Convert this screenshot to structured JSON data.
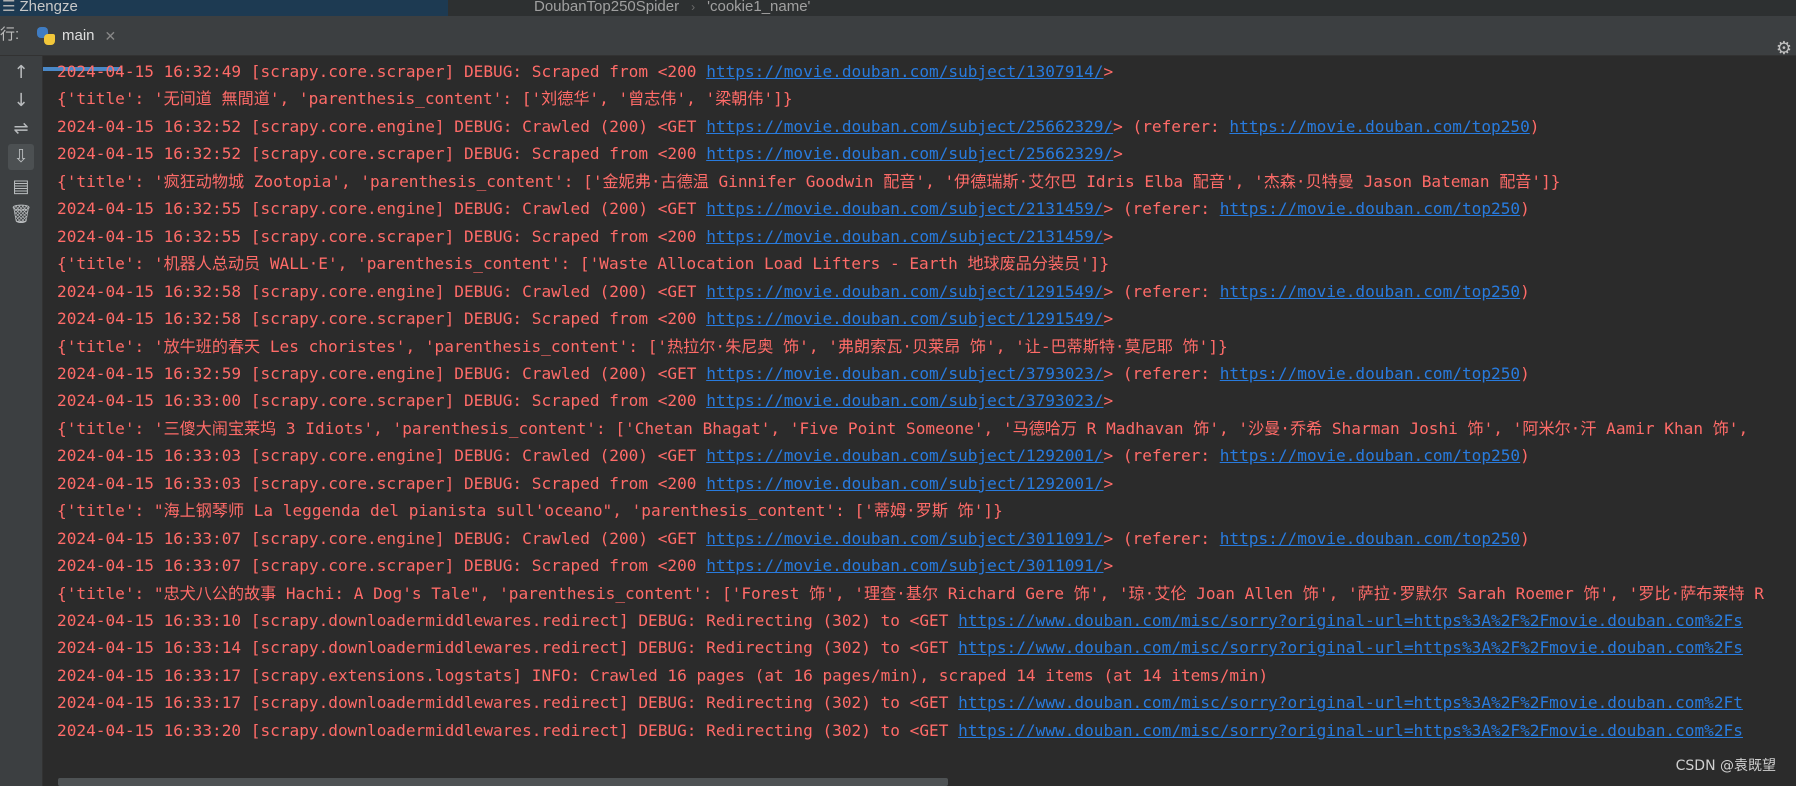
{
  "topbar": {
    "project_name": "Zhengze",
    "crumb_file": "DoubanTop250Spider",
    "crumb_symbol": "'cookie1_name'"
  },
  "run_panel": {
    "label": "行:",
    "tab_label": "main"
  },
  "toolbar": {
    "buttons": [
      "up-arrow-icon",
      "down-arrow-icon",
      "soft-wrap-icon",
      "scroll-to-end-icon",
      "print-icon",
      "trash-icon"
    ]
  },
  "console": {
    "text_color": "#ff6b68",
    "link_color": "#287bde",
    "lines": [
      {
        "text": "2024-04-15 16:32:49 [scrapy.core.scraper] DEBUG: Scraped from <200 ",
        "link": "https://movie.douban.com/subject/1307914/",
        "after": ">"
      },
      {
        "text": "{'title': '无间道 無間道', 'parenthesis_content': ['刘德华', '曾志伟', '梁朝伟']}"
      },
      {
        "text": "2024-04-15 16:32:52 [scrapy.core.engine] DEBUG: Crawled (200) <GET ",
        "link": "https://movie.douban.com/subject/25662329/",
        "after": "> (referer: ",
        "link2": "https://movie.douban.com/top250",
        "after2": ")"
      },
      {
        "text": "2024-04-15 16:32:52 [scrapy.core.scraper] DEBUG: Scraped from <200 ",
        "link": "https://movie.douban.com/subject/25662329/",
        "after": ">"
      },
      {
        "text": "{'title': '疯狂动物城 Zootopia', 'parenthesis_content': ['金妮弗·古德温 Ginnifer Goodwin 配音', '伊德瑞斯·艾尔巴 Idris Elba 配音', '杰森·贝特曼 Jason Bateman 配音']}"
      },
      {
        "text": "2024-04-15 16:32:55 [scrapy.core.engine] DEBUG: Crawled (200) <GET ",
        "link": "https://movie.douban.com/subject/2131459/",
        "after": "> (referer: ",
        "link2": "https://movie.douban.com/top250",
        "after2": ")"
      },
      {
        "text": "2024-04-15 16:32:55 [scrapy.core.scraper] DEBUG: Scraped from <200 ",
        "link": "https://movie.douban.com/subject/2131459/",
        "after": ">"
      },
      {
        "text": "{'title': '机器人总动员 WALL·E', 'parenthesis_content': ['Waste Allocation Load Lifters - Earth 地球废品分装员']}"
      },
      {
        "text": "2024-04-15 16:32:58 [scrapy.core.engine] DEBUG: Crawled (200) <GET ",
        "link": "https://movie.douban.com/subject/1291549/",
        "after": "> (referer: ",
        "link2": "https://movie.douban.com/top250",
        "after2": ")"
      },
      {
        "text": "2024-04-15 16:32:58 [scrapy.core.scraper] DEBUG: Scraped from <200 ",
        "link": "https://movie.douban.com/subject/1291549/",
        "after": ">"
      },
      {
        "text": "{'title': '放牛班的春天 Les choristes', 'parenthesis_content': ['热拉尔·朱尼奥 饰', '弗朗索瓦·贝莱昂 饰', '让-巴蒂斯特·莫尼耶 饰']}"
      },
      {
        "text": "2024-04-15 16:32:59 [scrapy.core.engine] DEBUG: Crawled (200) <GET ",
        "link": "https://movie.douban.com/subject/3793023/",
        "after": "> (referer: ",
        "link2": "https://movie.douban.com/top250",
        "after2": ")"
      },
      {
        "text": "2024-04-15 16:33:00 [scrapy.core.scraper] DEBUG: Scraped from <200 ",
        "link": "https://movie.douban.com/subject/3793023/",
        "after": ">"
      },
      {
        "text": "{'title': '三傻大闹宝莱坞 3 Idiots', 'parenthesis_content': ['Chetan Bhagat', 'Five Point Someone', '马德哈万 R Madhavan 饰', '沙曼·乔希 Sharman Joshi 饰', '阿米尔·汗 Aamir Khan 饰',"
      },
      {
        "text": "2024-04-15 16:33:03 [scrapy.core.engine] DEBUG: Crawled (200) <GET ",
        "link": "https://movie.douban.com/subject/1292001/",
        "after": "> (referer: ",
        "link2": "https://movie.douban.com/top250",
        "after2": ")"
      },
      {
        "text": "2024-04-15 16:33:03 [scrapy.core.scraper] DEBUG: Scraped from <200 ",
        "link": "https://movie.douban.com/subject/1292001/",
        "after": ">"
      },
      {
        "text": "{'title': \"海上钢琴师 La leggenda del pianista sull'oceano\", 'parenthesis_content': ['蒂姆·罗斯 饰']}"
      },
      {
        "text": "2024-04-15 16:33:07 [scrapy.core.engine] DEBUG: Crawled (200) <GET ",
        "link": "https://movie.douban.com/subject/3011091/",
        "after": "> (referer: ",
        "link2": "https://movie.douban.com/top250",
        "after2": ")"
      },
      {
        "text": "2024-04-15 16:33:07 [scrapy.core.scraper] DEBUG: Scraped from <200 ",
        "link": "https://movie.douban.com/subject/3011091/",
        "after": ">"
      },
      {
        "text": "{'title': \"忠犬八公的故事 Hachi: A Dog's Tale\", 'parenthesis_content': ['Forest 饰', '理查·基尔 Richard Gere 饰', '琼·艾伦 Joan Allen 饰', '萨拉·罗默尔 Sarah Roemer 饰', '罗比·萨布莱特 R"
      },
      {
        "text": "2024-04-15 16:33:10 [scrapy.downloadermiddlewares.redirect] DEBUG: Redirecting (302) to <GET ",
        "link": "https://www.douban.com/misc/sorry?original-url=https%3A%2F%2Fmovie.douban.com%2Fs"
      },
      {
        "text": "2024-04-15 16:33:14 [scrapy.downloadermiddlewares.redirect] DEBUG: Redirecting (302) to <GET ",
        "link": "https://www.douban.com/misc/sorry?original-url=https%3A%2F%2Fmovie.douban.com%2Fs"
      },
      {
        "text": "2024-04-15 16:33:17 [scrapy.extensions.logstats] INFO: Crawled 16 pages (at 16 pages/min), scraped 14 items (at 14 items/min)"
      },
      {
        "text": "2024-04-15 16:33:17 [scrapy.downloadermiddlewares.redirect] DEBUG: Redirecting (302) to <GET ",
        "link": "https://www.douban.com/misc/sorry?original-url=https%3A%2F%2Fmovie.douban.com%2Ft"
      },
      {
        "text": "2024-04-15 16:33:20 [scrapy.downloadermiddlewares.redirect] DEBUG: Redirecting (302) to <GET ",
        "link": "https://www.douban.com/misc/sorry?original-url=https%3A%2F%2Fmovie.douban.com%2Fs"
      }
    ]
  },
  "watermark": "CSDN @袁既望"
}
